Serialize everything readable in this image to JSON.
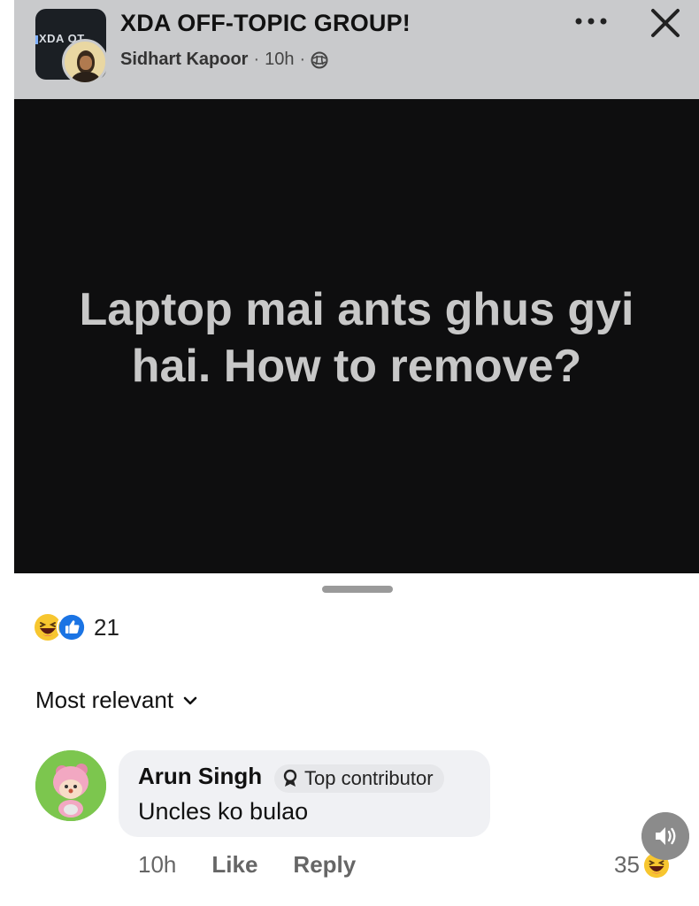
{
  "header": {
    "group_thumb_text": "XDA OT",
    "group_name": "XDA OFF-TOPIC GROUP!",
    "author": "Sidhart Kapoor",
    "separator": "·",
    "time": "10h",
    "separator2": "·",
    "privacy_icon": "globe-icon",
    "menu_icon": "more-dots-icon",
    "close_icon": "close-icon"
  },
  "post": {
    "line1": "Laptop mai ants ghus gyi",
    "line2": "hai. How to remove?"
  },
  "reactions": {
    "icons": [
      "haha-icon",
      "like-icon"
    ],
    "count": "21"
  },
  "comments_section": {
    "sort_label": "Most relevant",
    "sort_icon": "chevron-down-icon"
  },
  "comment": {
    "author": "Arun Singh",
    "badge": "Top contributor",
    "text": "Uncles ko bulao",
    "time": "10h",
    "like_label": "Like",
    "reply_label": "Reply",
    "reaction_count": "35",
    "reaction_icon": "haha-icon"
  },
  "colors": {
    "header_bg": "#c9cacc",
    "post_bg": "#0e0e0f",
    "post_text": "#c8c8c8",
    "like_blue": "#1b74e4",
    "haha_yellow": "#f7c62f",
    "bubble_bg": "#f0f1f4"
  }
}
